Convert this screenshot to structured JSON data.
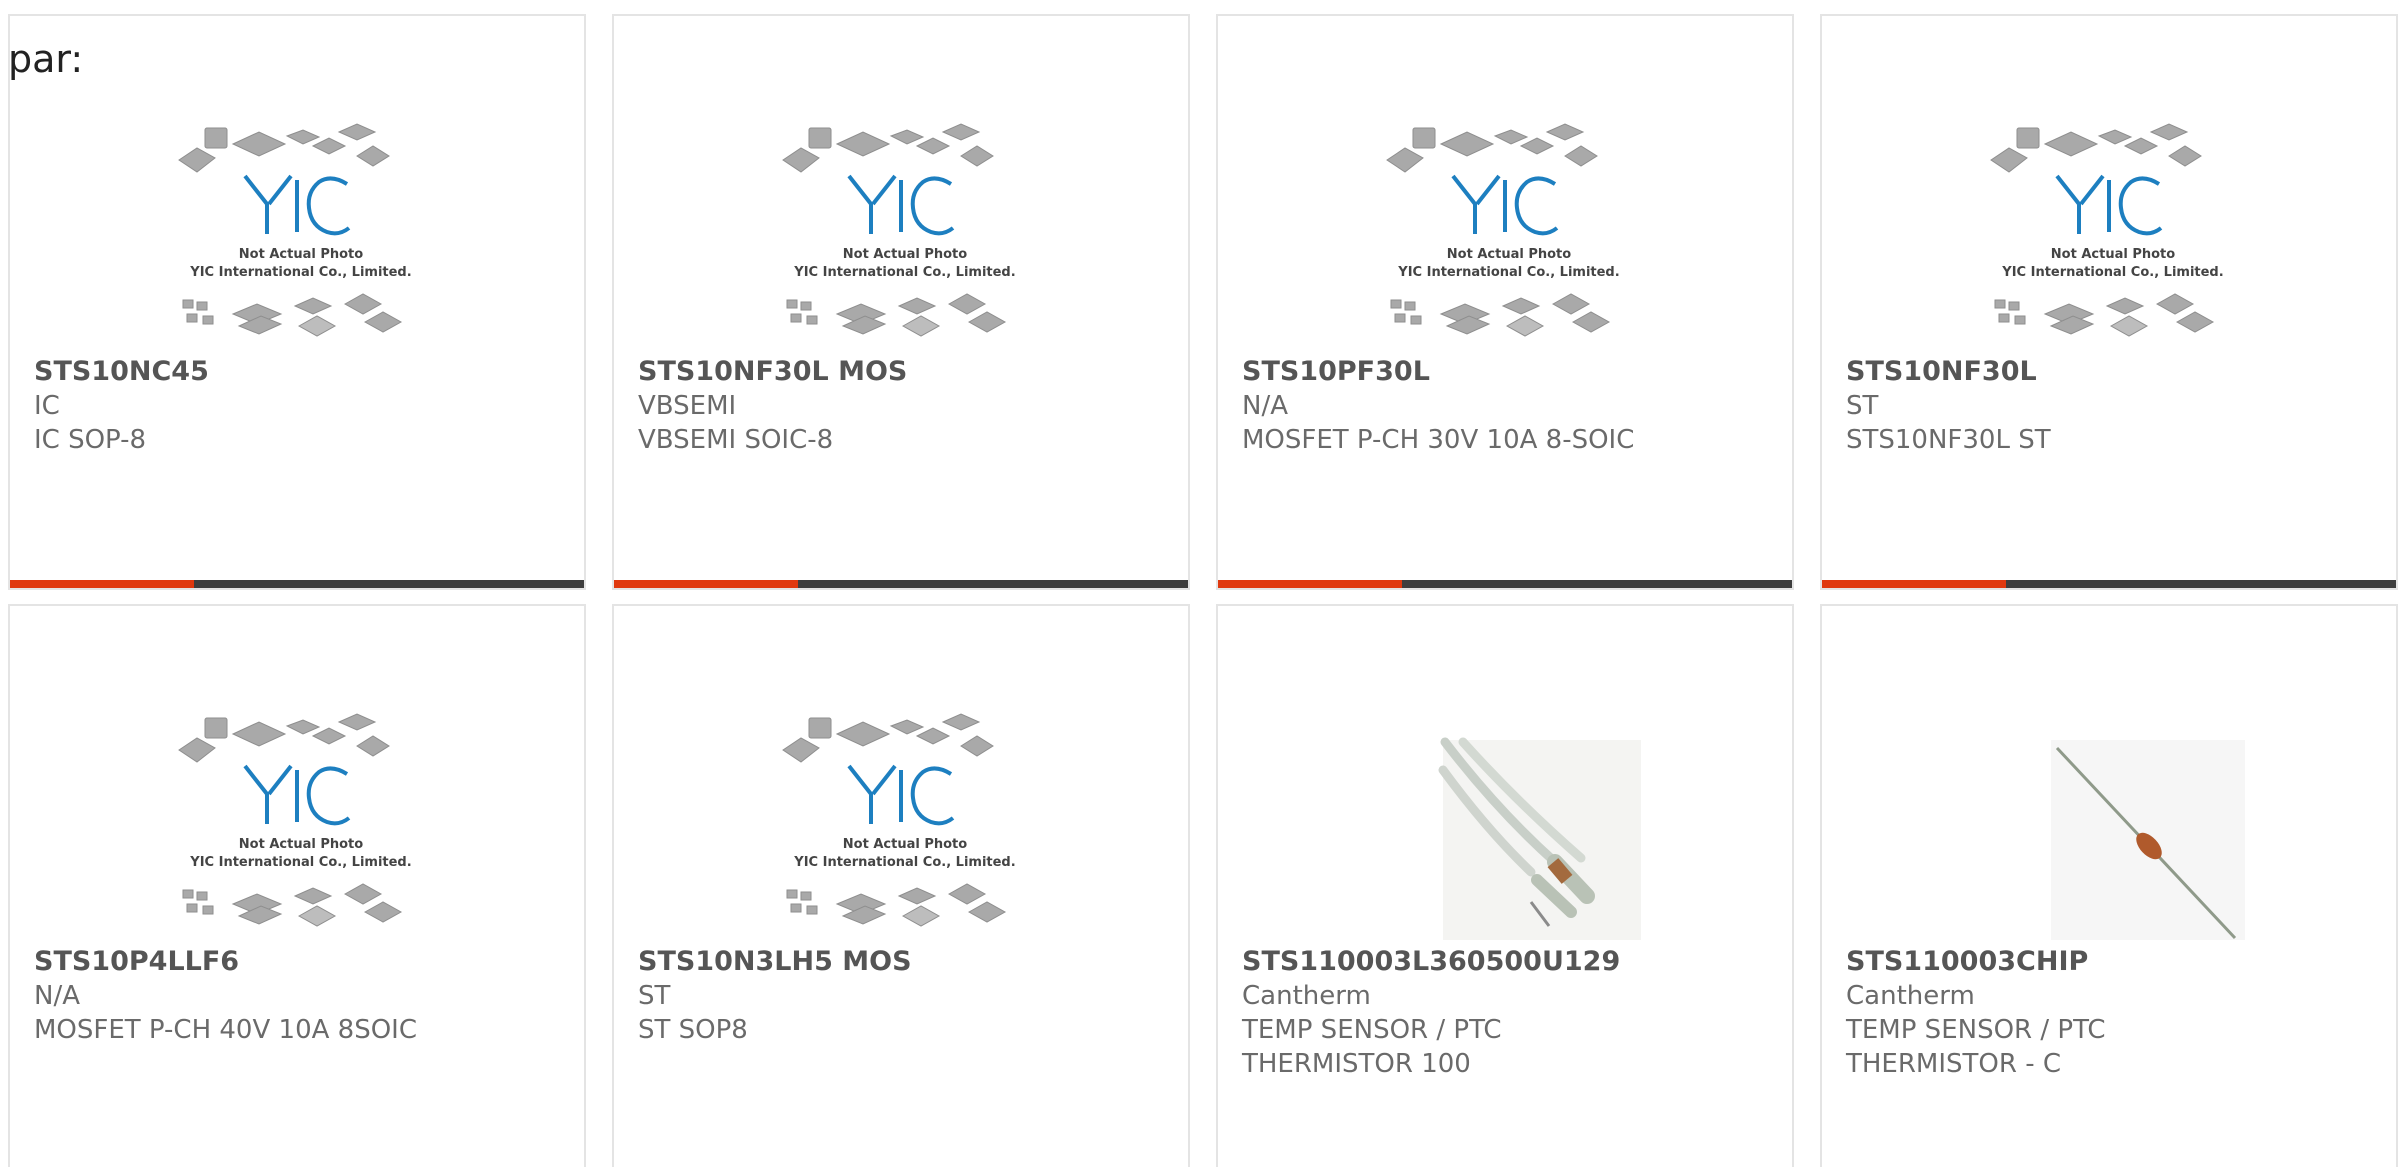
{
  "prefix_text": "par:",
  "placeholder": {
    "line1": "Not Actual Photo",
    "line2": "YIC International Co., Limited.",
    "logo_text": "YIC"
  },
  "colors": {
    "accent": "#e0390f",
    "bar": "#3e3e3e",
    "logo": "#1a8ac8",
    "border": "#e4e4e4"
  },
  "products": [
    {
      "name": "STS10NC45",
      "manufacturer": "IC",
      "description": "IC SOP-8",
      "image": "placeholder-logo"
    },
    {
      "name": "STS10NF30L MOS",
      "manufacturer": "VBSEMI",
      "description": "VBSEMI SOIC-8",
      "image": "placeholder-logo"
    },
    {
      "name": "STS10PF30L",
      "manufacturer": "N/A",
      "description": "MOSFET P-CH 30V 10A 8-SOIC",
      "image": "placeholder-logo"
    },
    {
      "name": "STS10NF30L",
      "manufacturer": "ST",
      "description": "STS10NF30L ST",
      "image": "placeholder-logo"
    },
    {
      "name": "STS10P4LLF6",
      "manufacturer": "N/A",
      "description": "MOSFET P-CH 40V 10A 8SOIC",
      "image": "placeholder-logo"
    },
    {
      "name": "STS10N3LH5 MOS",
      "manufacturer": "ST",
      "description": "ST SOP8",
      "image": "placeholder-logo"
    },
    {
      "name": "STS110003L360500U129",
      "manufacturer": "Cantherm",
      "description": "TEMP SENSOR / PTC",
      "description2": "THERMISTOR 100",
      "image": "thermistor-wire-photo"
    },
    {
      "name": "STS110003CHIP",
      "manufacturer": "Cantherm",
      "description": "TEMP SENSOR / PTC",
      "description2": "THERMISTOR - C",
      "image": "thermistor-axial-photo"
    }
  ]
}
